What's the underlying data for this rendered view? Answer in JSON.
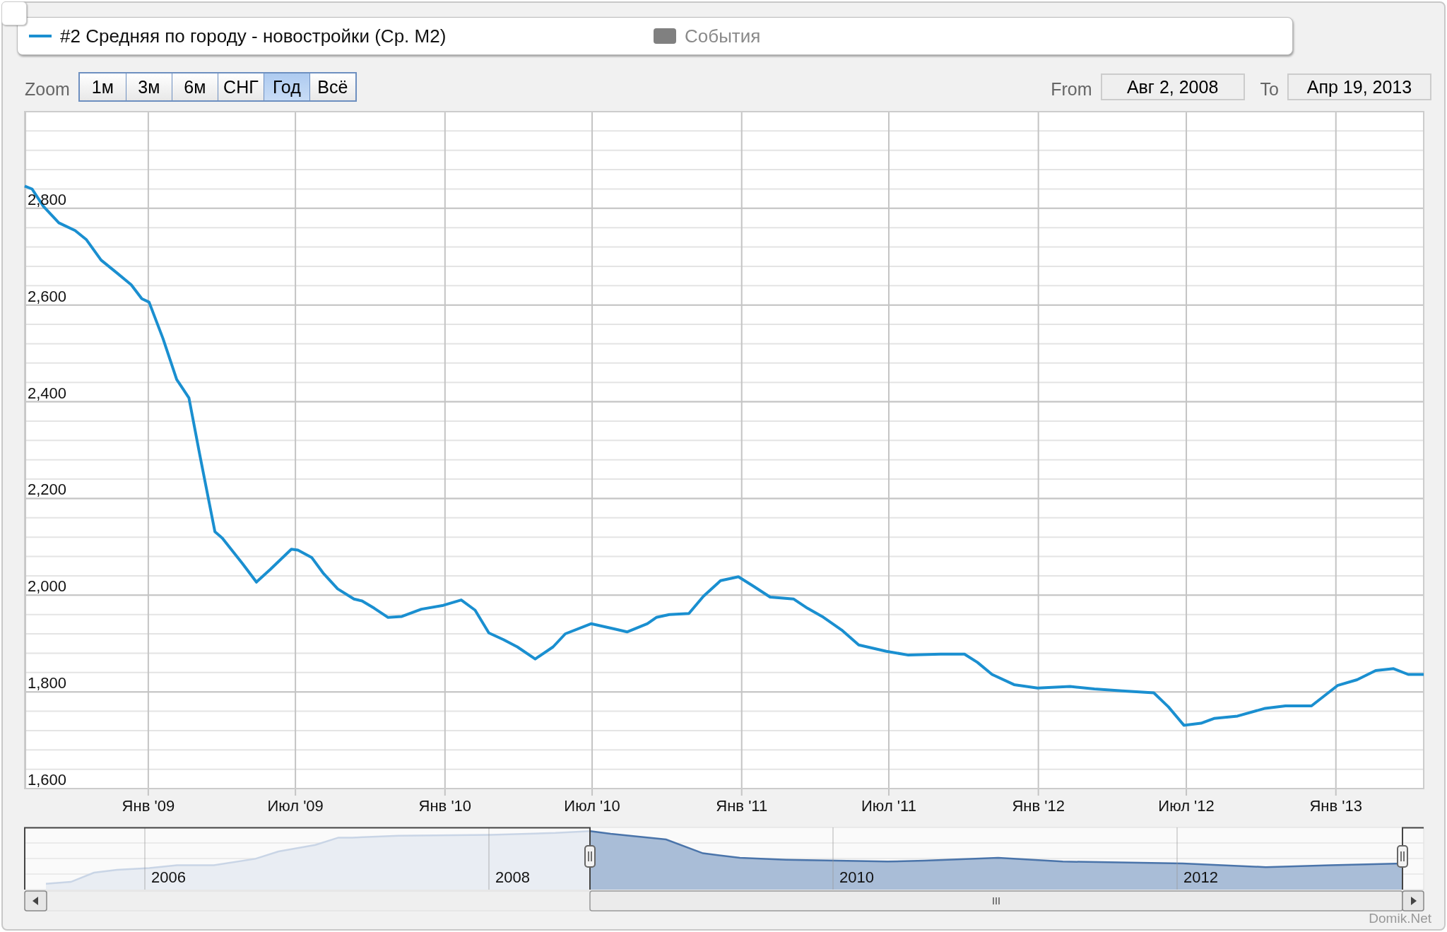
{
  "legend": {
    "items": [
      {
        "label": "#2 Средняя по городу - новостройки (Ср. М2)",
        "color": "#1a8fd0",
        "kind": "line",
        "hidden": false
      },
      {
        "label": "События",
        "color": "#808080",
        "kind": "box",
        "hidden": true
      }
    ]
  },
  "range_selector": {
    "zoom_label": "Zoom",
    "buttons": [
      {
        "label": "1м",
        "selected": false
      },
      {
        "label": "3м",
        "selected": false
      },
      {
        "label": "6м",
        "selected": false
      },
      {
        "label": "СНГ",
        "selected": false
      },
      {
        "label": "Год",
        "selected": true
      },
      {
        "label": "Всё",
        "selected": false
      }
    ],
    "from_label": "From",
    "from_value": "Авг 2, 2008",
    "to_label": "To",
    "to_value": "Апр 19, 2013"
  },
  "chart": {
    "chart_data": {
      "type": "line",
      "x": [
        "2008-08-02",
        "2008-08-11",
        "2008-08-25",
        "2008-09-13",
        "2008-10-03",
        "2008-10-17",
        "2008-11-04",
        "2008-11-23",
        "2008-12-11",
        "2008-12-24",
        "2009-01-02",
        "2009-01-19",
        "2009-02-05",
        "2009-02-20",
        "2009-03-05",
        "2009-03-24",
        "2009-04-02",
        "2009-04-27",
        "2009-05-14",
        "2009-05-31",
        "2009-06-26",
        "2009-07-04",
        "2009-07-21",
        "2009-08-04",
        "2009-08-22",
        "2009-09-11",
        "2009-09-21",
        "2009-10-06",
        "2009-10-23",
        "2009-11-09",
        "2009-12-03",
        "2009-12-30",
        "2010-01-21",
        "2010-02-07",
        "2010-02-24",
        "2010-03-14",
        "2010-03-31",
        "2010-04-22",
        "2010-05-14",
        "2010-05-29",
        "2010-06-30",
        "2010-07-29",
        "2010-08-13",
        "2010-09-07",
        "2010-09-18",
        "2010-10-04",
        "2010-10-28",
        "2010-11-15",
        "2010-12-06",
        "2010-12-28",
        "2011-01-15",
        "2011-02-05",
        "2011-03-06",
        "2011-03-23",
        "2011-04-10",
        "2011-05-04",
        "2011-05-25",
        "2011-06-28",
        "2011-07-25",
        "2011-09-03",
        "2011-10-02",
        "2011-10-18",
        "2011-11-05",
        "2011-12-02",
        "2011-12-31",
        "2012-02-09",
        "2012-03-10",
        "2012-04-13",
        "2012-05-22",
        "2012-06-09",
        "2012-06-28",
        "2012-07-19",
        "2012-08-04",
        "2012-09-02",
        "2012-10-06",
        "2012-10-31",
        "2012-12-02",
        "2013-01-03",
        "2013-01-27",
        "2013-02-19",
        "2013-03-13",
        "2013-03-31",
        "2013-04-19"
      ],
      "series": [
        {
          "color": "#1a8fd0",
          "values": [
            2846,
            2840,
            2804,
            2770,
            2754,
            2735,
            2693,
            2667,
            2642,
            2613,
            2606,
            2531,
            2446,
            2408,
            2293,
            2131,
            2118,
            2065,
            2027,
            2053,
            2095,
            2093,
            2078,
            2046,
            2013,
            1992,
            1988,
            1973,
            1954,
            1956,
            1971,
            1979,
            1990,
            1969,
            1922,
            1908,
            1893,
            1868,
            1893,
            1920,
            1941,
            1930,
            1924,
            1941,
            1954,
            1960,
            1962,
            1998,
            2030,
            2038,
            2019,
            1996,
            1992,
            1973,
            1956,
            1928,
            1897,
            1884,
            1876,
            1878,
            1878,
            1861,
            1836,
            1815,
            1808,
            1811,
            1806,
            1802,
            1798,
            1769,
            1731,
            1735,
            1745,
            1750,
            1766,
            1771,
            1771,
            1813,
            1825,
            1844,
            1848,
            1836,
            1836
          ]
        }
      ],
      "grid": true,
      "xlim": [
        "2008-08-02",
        "2013-04-19"
      ],
      "ylim": [
        1600,
        3000
      ],
      "xticks": [
        {
          "value": "2009-01-01",
          "label": "Янв '09"
        },
        {
          "value": "2009-07-01",
          "label": "Июл '09"
        },
        {
          "value": "2010-01-01",
          "label": "Янв '10"
        },
        {
          "value": "2010-07-01",
          "label": "Июл '10"
        },
        {
          "value": "2011-01-01",
          "label": "Янв '11"
        },
        {
          "value": "2011-07-01",
          "label": "Июл '11"
        },
        {
          "value": "2012-01-01",
          "label": "Янв '12"
        },
        {
          "value": "2012-07-01",
          "label": "Июл '12"
        },
        {
          "value": "2013-01-01",
          "label": "Янв '13"
        }
      ],
      "yticks": [
        {
          "value": 1600,
          "label": "1,600"
        },
        {
          "value": 1800,
          "label": "1,800"
        },
        {
          "value": 2000,
          "label": "2,000"
        },
        {
          "value": 2200,
          "label": "2,200"
        },
        {
          "value": 2400,
          "label": "2,400"
        },
        {
          "value": 2600,
          "label": "2,600"
        },
        {
          "value": 2800,
          "label": "2,800"
        }
      ]
    }
  },
  "navigator": {
    "year_labels": [
      "2006",
      "2008",
      "2010",
      "2012"
    ]
  },
  "credits": "Domik.Net"
}
